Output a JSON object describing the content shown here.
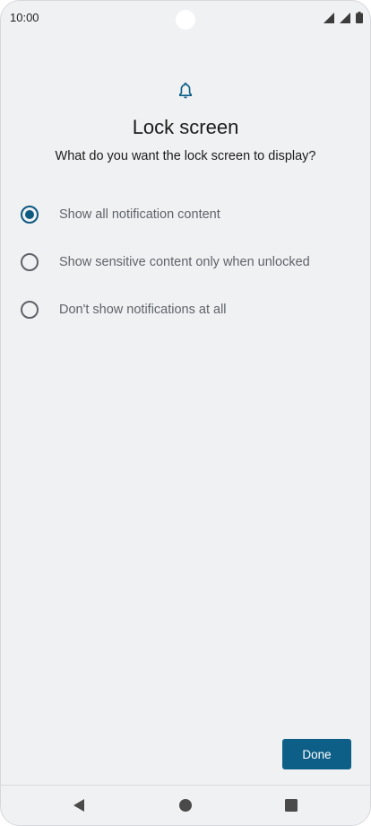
{
  "status_bar": {
    "time": "10:00",
    "icons": [
      "signal-icon",
      "signal-icon",
      "battery-icon"
    ]
  },
  "header": {
    "icon": "bell-icon",
    "title": "Lock screen",
    "subtitle": "What do you want the lock screen to display?"
  },
  "options": [
    {
      "label": "Show all notification content",
      "selected": true
    },
    {
      "label": "Show sensitive content only when unlocked",
      "selected": false
    },
    {
      "label": "Don't show notifications at all",
      "selected": false
    }
  ],
  "footer": {
    "done_label": "Done"
  },
  "navigation": {
    "icons": [
      "back-icon",
      "home-icon",
      "recents-icon"
    ]
  },
  "colors": {
    "accent": "#0e5f88",
    "background": "#f0f1f3",
    "label": "#5f6368"
  }
}
